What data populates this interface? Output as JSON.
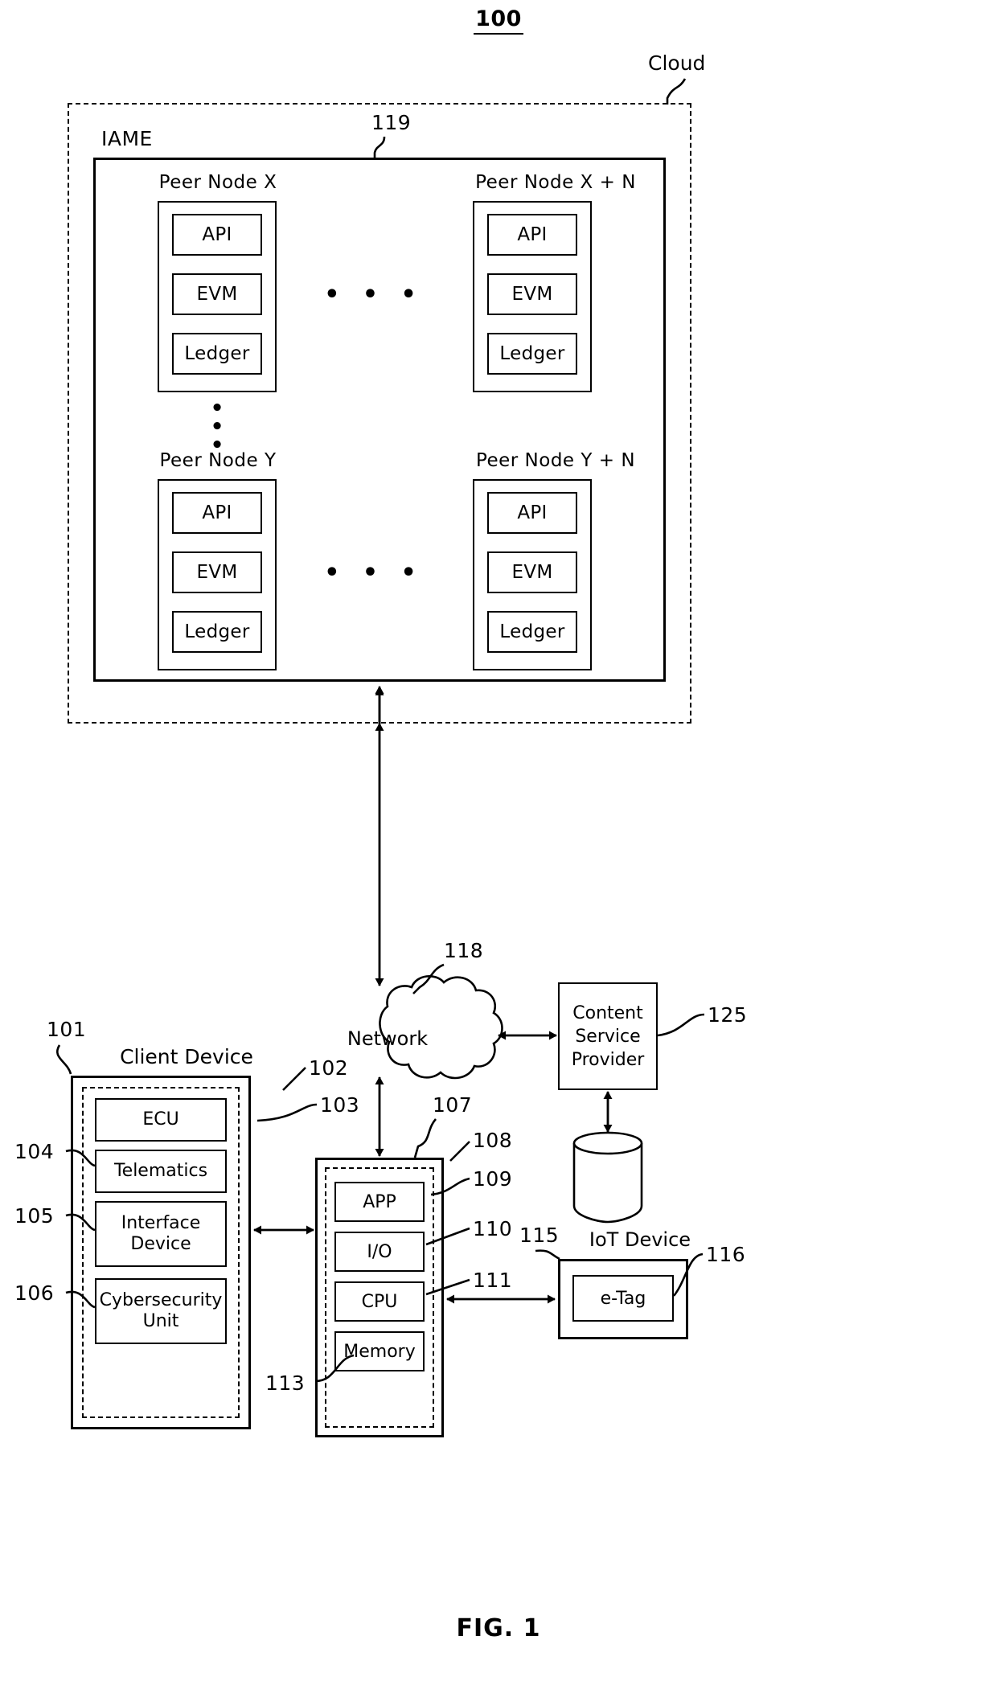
{
  "figure": {
    "number": "100",
    "caption": "FIG. 1"
  },
  "cloud": {
    "label": "Cloud"
  },
  "iame": {
    "label": "IAME",
    "ref": "119",
    "peer_nodes": [
      {
        "title": "Peer Node  X",
        "components": [
          "API",
          "EVM",
          "Ledger"
        ]
      },
      {
        "title": "Peer Node  X + N",
        "components": [
          "API",
          "EVM",
          "Ledger"
        ]
      },
      {
        "title": "Peer Node  Y",
        "components": [
          "API",
          "EVM",
          "Ledger"
        ]
      },
      {
        "title": "Peer Node  Y + N",
        "components": [
          "API",
          "EVM",
          "Ledger"
        ]
      }
    ],
    "horizontal_ellipsis": "• • •",
    "vertical_ellipsis": "•"
  },
  "client_device": {
    "title": "Client  Device",
    "ref_outer": "101",
    "ref_dashed": "102",
    "items": [
      {
        "label": "ECU",
        "ref": "103"
      },
      {
        "label": "Telematics",
        "ref": "104"
      },
      {
        "label": "Interface\nDevice",
        "line1": "Interface",
        "line2": "Device",
        "ref": "105"
      },
      {
        "label": "Cybersecurity\nUnit",
        "line1": "Cybersecurity",
        "line2": "Unit",
        "ref": "106"
      }
    ]
  },
  "server": {
    "ref_outer": "107",
    "ref_dashed": "108",
    "items": [
      {
        "label": "APP",
        "ref": "109"
      },
      {
        "label": "I/O",
        "ref": "110"
      },
      {
        "label": "CPU",
        "ref": "111"
      },
      {
        "label": "Memory",
        "ref": "113"
      }
    ]
  },
  "network": {
    "label": "Network",
    "ref": "118"
  },
  "content_service_provider": {
    "line1": "Content",
    "line2": "Service",
    "line3": "Provider",
    "ref": "125"
  },
  "database": {
    "name": "database-cylinder"
  },
  "iot_device": {
    "title": "IoT  Device",
    "ref": "115",
    "tag_label": "e-Tag",
    "tag_ref": "116"
  },
  "colors": {
    "stroke": "#000000",
    "background": "#ffffff"
  }
}
